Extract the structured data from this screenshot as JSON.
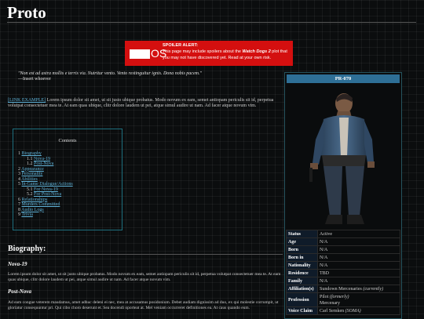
{
  "page": {
    "title": "Proto"
  },
  "spoiler": {
    "logo_text": "",
    "os_text": "OS",
    "title": "SPOILER ALERT:",
    "text_a": "This page may include spoilers about the ",
    "text_game": "Watch Dogs 2",
    "text_b": " plot that you may not have discovered yet. Read at your own risk."
  },
  "quote": {
    "text": "\"Non est ad astra mollis e terris via. Nutritur vento. Vento restinguitur ignis. Dona nobis pacem.\"",
    "author": "—Insert whoever"
  },
  "intro": {
    "link": "[LINK EXAMPLE]",
    "text": " Lorem ipsum dolor sit amet, ut sit justo ubique probatus. Modo novum ex eam, semet antiopam periculis sit id, perpetua volutpat consectetuer mea te. At eam quas ubique, clitr dolore laudem ut pei, atque simul audire ut nam. Ad facer atque novum vim."
  },
  "toc": {
    "title": "Contents",
    "items": [
      {
        "num": "1",
        "label": "Biography",
        "indent": 0
      },
      {
        "num": "1.1",
        "label": "Nova-19",
        "indent": 1
      },
      {
        "num": "1.2",
        "label": "Post-Nova",
        "indent": 1
      },
      {
        "num": "2",
        "label": "Appearance",
        "indent": 0
      },
      {
        "num": "3",
        "label": "Personality",
        "indent": 0
      },
      {
        "num": "4",
        "label": "Abilities",
        "indent": 0
      },
      {
        "num": "5",
        "label": "In-Game Dialogue/Actions",
        "indent": 0
      },
      {
        "num": "5.1",
        "label": "For Nova-19",
        "indent": 1
      },
      {
        "num": "5.2",
        "label": "For Post-Nova",
        "indent": 1
      },
      {
        "num": "6",
        "label": "Relationships",
        "indent": 0
      },
      {
        "num": "7",
        "label": "Murders Committed",
        "indent": 0
      },
      {
        "num": "8",
        "label": "Audio Logs",
        "indent": 0
      },
      {
        "num": "9",
        "label": "Trivia",
        "indent": 0
      }
    ]
  },
  "biography": {
    "heading": "Biography:",
    "nova_heading": "Nova-19",
    "nova_text": "Lorem ipsum dolor sit amet, ut sit justo ubique probatus. Modo novum ex eam, semet antiopam periculis sit id, perpetua volutpat consectetuer mea te. At eam quas ubique, clitr dolore laudem ut pei, atque simul audire ut nam. Ad facer atque novum vim.",
    "post_heading": "Post-Nova",
    "post_text": "Ad eam congue veterem maudamus, amet adhuc deleni ei nec, mea at accusamus posidonium. Debet audiam dignissim ad duo, ex qui molestie corrumpit, ut gloriatur consequuntur pri. Qui cibo choro deserunt et. Sea docendi oporteat at. Mel veniam occurreret definitiones ea. At caus quando eum."
  },
  "infobox": {
    "header": "PR-070",
    "rows": [
      {
        "key": "Status",
        "value": "Active"
      },
      {
        "key": "Age",
        "value": "N/A"
      },
      {
        "key": "Born",
        "value": "N/A"
      },
      {
        "key": "Born in",
        "value": "N/A"
      },
      {
        "key": "Nationality",
        "value": "N/A"
      },
      {
        "key": "Residence",
        "value": "TBD"
      },
      {
        "key": "Family",
        "value": "N/A"
      },
      {
        "key": "Affiliation(s)",
        "value": "Sundown Mercenaries",
        "note": "(currently)"
      },
      {
        "key": "Profession",
        "value": "Pilot",
        "note": "(formerly)",
        "value2": "Mercenary"
      },
      {
        "key": "Voice Claim",
        "value": "Carl Semken",
        "note": "(SOMA)"
      }
    ]
  },
  "colors": {
    "background": "#0b0d0e",
    "spoiler_red": "#d40f0f",
    "link": "#5fb2d8",
    "infobox_header": "#2e6f96",
    "infobox_key": "#0f1b29"
  }
}
